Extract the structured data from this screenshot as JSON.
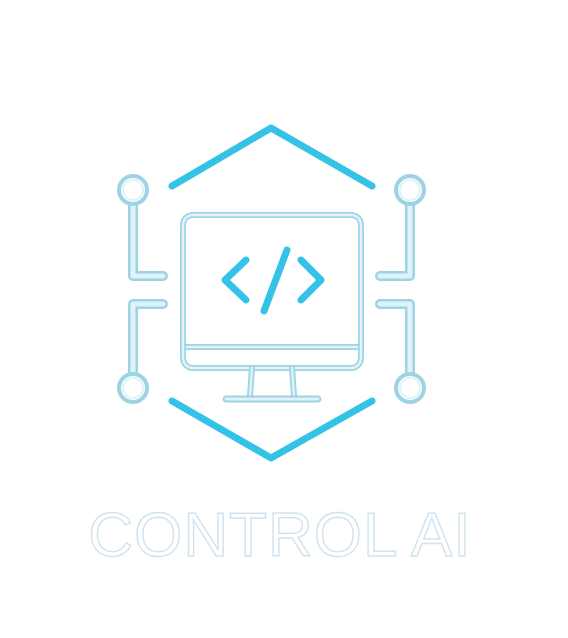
{
  "brand": {
    "name": "CONTROL AI",
    "logo_icon": "monitor-code-circuit-icon"
  },
  "colors": {
    "background": "#ffffff",
    "accent": "#34c3e6",
    "light_accent": "#c4e8f1",
    "light_accent_stroke": "#9ed3e3",
    "wordmark_outline": "#cfe3ee"
  }
}
